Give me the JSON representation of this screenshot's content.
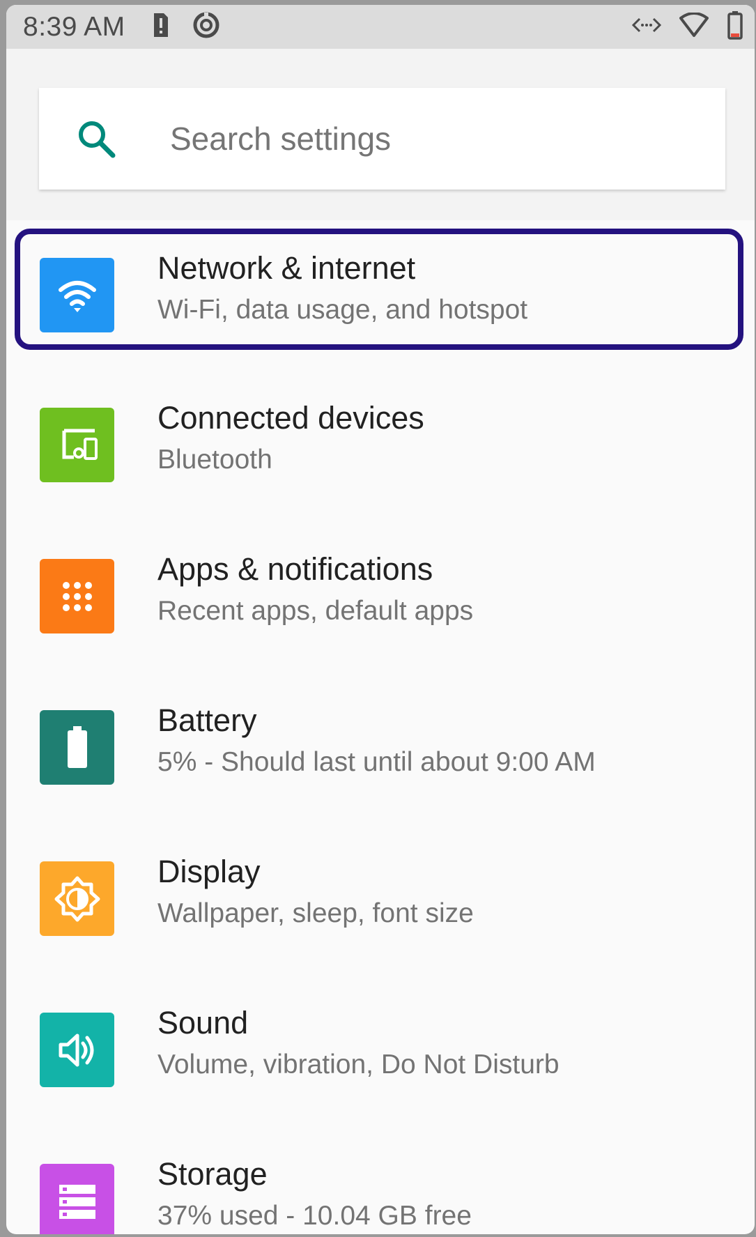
{
  "statusbar": {
    "time": "8:39 AM",
    "icons": [
      "sim-alert-icon",
      "data-saver-icon",
      "data-transfer-icon",
      "wifi-icon",
      "battery-icon"
    ]
  },
  "search": {
    "placeholder": "Search settings"
  },
  "items": [
    {
      "title": "Network & internet",
      "summary": "Wi-Fi, data usage, and hotspot",
      "icon": "wifi-icon",
      "color": "#2196f3"
    },
    {
      "title": "Connected devices",
      "summary": "Bluetooth",
      "icon": "devices-icon",
      "color": "#6fbf20"
    },
    {
      "title": "Apps & notifications",
      "summary": "Recent apps, default apps",
      "icon": "apps-icon",
      "color": "#fb7a16"
    },
    {
      "title": "Battery",
      "summary": "5% - Should last until about 9:00 AM",
      "icon": "battery-icon",
      "color": "#1f7f72"
    },
    {
      "title": "Display",
      "summary": "Wallpaper, sleep, font size",
      "icon": "brightness-icon",
      "color": "#fda82b"
    },
    {
      "title": "Sound",
      "summary": "Volume, vibration, Do Not Disturb",
      "icon": "volume-icon",
      "color": "#13b3a8"
    },
    {
      "title": "Storage",
      "summary": "37% used - 10.04 GB free",
      "icon": "storage-icon",
      "color": "#c850e6"
    }
  ],
  "highlight_color": "#24127f"
}
